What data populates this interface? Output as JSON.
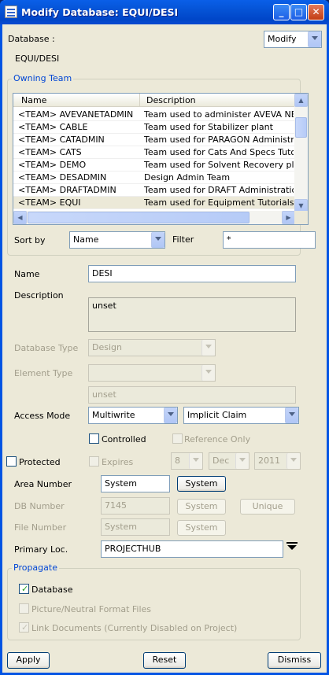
{
  "window": {
    "title": "Modify Database: EQUI/DESI"
  },
  "header": {
    "database_label": "Database :",
    "database_value": "EQUI/DESI",
    "mode": "Modify"
  },
  "owning_team": {
    "title": "Owning Team",
    "columns": [
      "Name",
      "Description"
    ],
    "rows": [
      {
        "name": "<TEAM>  AVEVANETADMIN",
        "description": "Team used to administer AVEVA NET G"
      },
      {
        "name": "<TEAM>  CABLE",
        "description": "Team used for Stabilizer plant"
      },
      {
        "name": "<TEAM>  CATADMIN",
        "description": "Team used for PARAGON Administrati"
      },
      {
        "name": "<TEAM>  CATS",
        "description": "Team used for Cats And Specs Tutorial"
      },
      {
        "name": "<TEAM>  DEMO",
        "description": "Team used for Solvent Recovery plant"
      },
      {
        "name": "<TEAM>  DESADMIN",
        "description": "Design Admin Team"
      },
      {
        "name": "<TEAM>  DRAFTADMIN",
        "description": "Team used for DRAFT Administration da"
      },
      {
        "name": "<TEAM>  EQUI",
        "description": "Team used for Equipment Tutorials"
      }
    ],
    "sort_by_label": "Sort by",
    "sort_by_value": "Name",
    "filter_label": "Filter",
    "filter_value": "*"
  },
  "form": {
    "name_label": "Name",
    "name_value": "DESI",
    "description_label": "Description",
    "description_value": "unset",
    "db_type_label": "Database Type",
    "db_type_value": "Design",
    "element_type_label": "Element Type",
    "element_type_value": "",
    "element_text": "unset",
    "access_mode_label": "Access Mode",
    "access_mode_value": "Multiwrite",
    "claim_value": "Implicit Claim",
    "controlled_label": "Controlled",
    "reference_only_label": "Reference Only",
    "protected_label": "Protected",
    "expires_label": "Expires",
    "expires_day": "8",
    "expires_month": "Dec",
    "expires_year": "2011",
    "area_number_label": "Area Number",
    "area_number_value": "System",
    "area_system_button": "System",
    "db_number_label": "DB Number",
    "db_number_value": "7145",
    "db_system_button": "System",
    "unique_button": "Unique",
    "file_number_label": "File Number",
    "file_number_value": "System",
    "file_system_button": "System",
    "primary_loc_label": "Primary Loc.",
    "primary_loc_value": "PROJECTHUB"
  },
  "propagate": {
    "title": "Propagate",
    "database_label": "Database",
    "database_checked": true,
    "picture_label": "Picture/Neutral Format Files",
    "picture_checked": false,
    "link_docs_label": "Link Documents (Currently Disabled on Project)",
    "link_docs_checked": true
  },
  "footer": {
    "apply": "Apply",
    "reset": "Reset",
    "dismiss": "Dismiss"
  }
}
